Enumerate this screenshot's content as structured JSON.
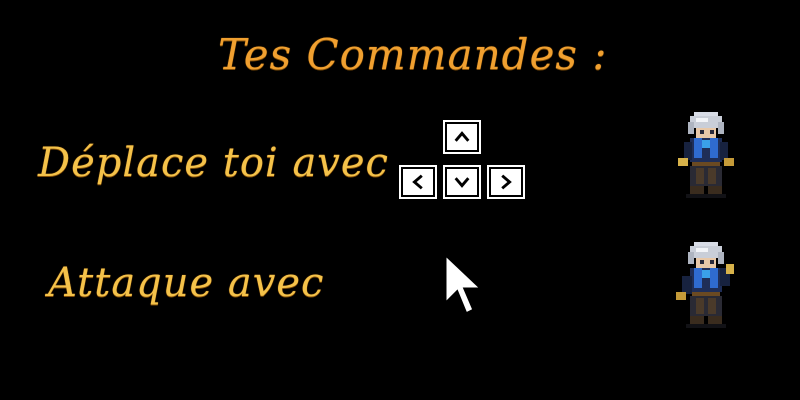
{
  "screen": {
    "title": "Tes Commandes :",
    "rows": [
      {
        "label": "Déplace toi avec",
        "input": "arrow-keys"
      },
      {
        "label": "Attaque avec",
        "input": "mouse-click"
      }
    ]
  },
  "colors": {
    "background": "#000000",
    "title": "#f0a030",
    "label": "#f4c24a",
    "key_face": "#ffffff",
    "key_glyph": "#000000"
  },
  "icons": {
    "up": "arrow-up-key-icon",
    "left": "arrow-left-key-icon",
    "down": "arrow-down-key-icon",
    "right": "arrow-right-key-icon",
    "cursor": "mouse-cursor-icon",
    "character": "character-sprite"
  }
}
